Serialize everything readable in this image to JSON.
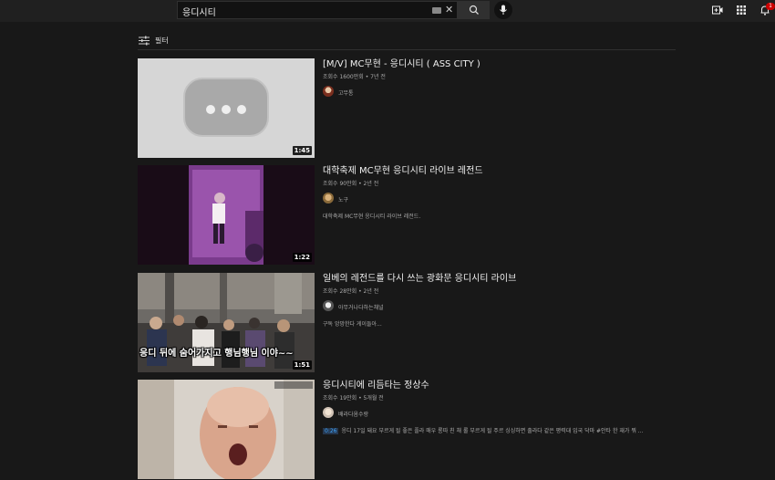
{
  "search": {
    "query": "응디시티"
  },
  "notifications": {
    "count": "1"
  },
  "filter": {
    "label": "필터"
  },
  "results": [
    {
      "title": "[M/V] MC무현 - 응디시티 ( ASS CITY )",
      "views": "조회수 1600만회",
      "age": "7년 전",
      "channel": "고무통",
      "duration": "1:45",
      "description": ""
    },
    {
      "title": "대학축제 MC무현 응디시티 라이브 레전드",
      "views": "조회수 90만회",
      "age": "2년 전",
      "channel": "노구",
      "duration": "1:22",
      "description": "대학축제 MC무현 응디시티 라이브 레전드."
    },
    {
      "title": "일베의 레전드를 다시 쓰는 광화문 응디시티 라이브",
      "views": "조회수 28만회",
      "age": "2년 전",
      "channel": "아무거나다하는채널",
      "duration": "1:51",
      "description": "구독 앙망한다 게이들아...",
      "caption": "응디 뒤에 숨어가지고 행님행님 이야~~"
    },
    {
      "title": "응디시티에 리듬타는 정상수",
      "views": "조회수 19만회",
      "age": "5개월 전",
      "channel": "배라다옴수랑",
      "duration": "",
      "timestamp": "0:26",
      "description": "응디 17일 돼요 부르게 될 좋은 플라 매우 롱따 친 채 롤 부르게 될 주르 싱싱하면 출라다 같은 평력대 입국 닥마 #안타 한 재가 뭐 ..."
    }
  ]
}
